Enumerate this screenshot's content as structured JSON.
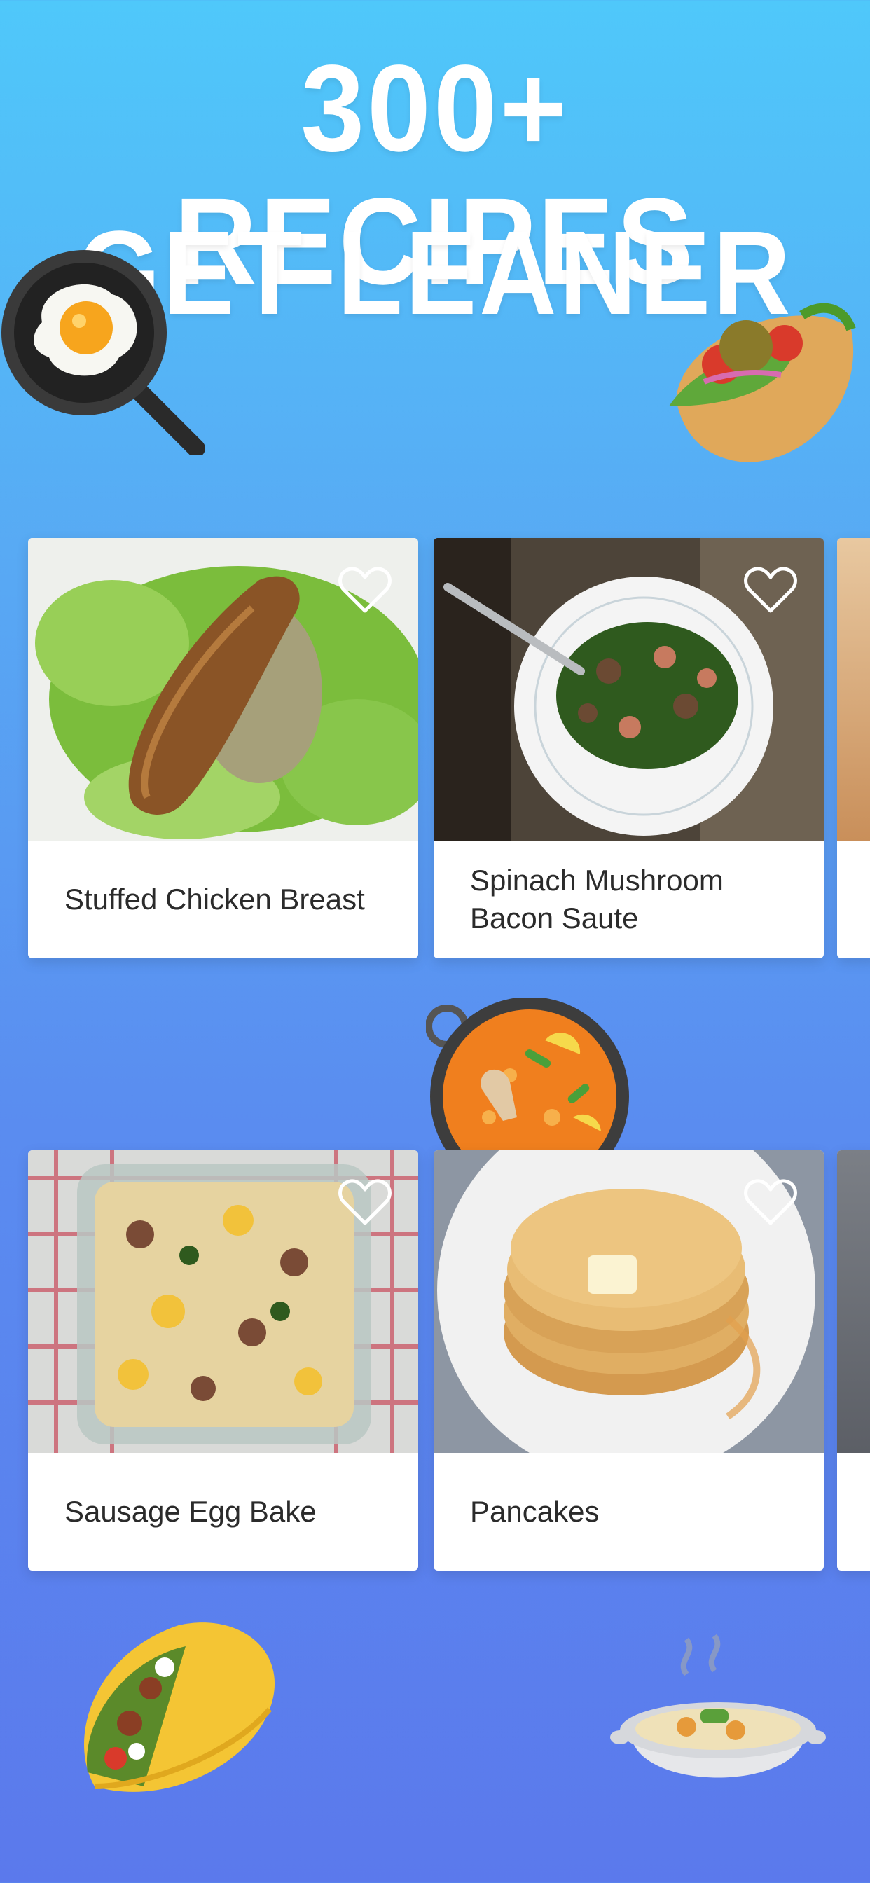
{
  "headline": {
    "line1": "300+ RECIPES",
    "line2": "GET LEANER"
  },
  "stickers": [
    "frying-pan-egg-icon",
    "stuffed-flatbread-icon",
    "paella-pan-icon",
    "taco-icon",
    "stew-bowl-icon"
  ],
  "recipes_row1": [
    {
      "title": "Stuffed Chicken Breast",
      "favorited": false
    },
    {
      "title": "Spinach Mushroom Bacon Saute",
      "favorited": false
    }
  ],
  "recipes_row2": [
    {
      "title": "Sausage Egg Bake",
      "favorited": false
    },
    {
      "title": "Pancakes",
      "favorited": false
    }
  ],
  "colors": {
    "background_top": "#4fc8fa",
    "background_bottom": "#5b79ec",
    "card": "#ffffff",
    "text": "#2b2b2b"
  }
}
